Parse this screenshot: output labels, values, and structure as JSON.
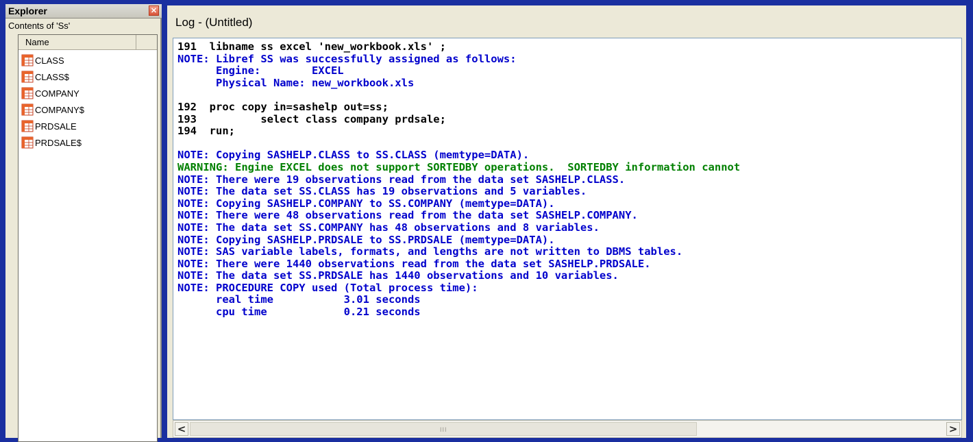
{
  "explorer": {
    "title": "Explorer",
    "close_icon": "close-icon",
    "contents_label": "Contents of 'Ss'",
    "column_header": "Name",
    "items": [
      {
        "label": "CLASS",
        "icon": "dataset-icon"
      },
      {
        "label": "CLASS$",
        "icon": "dataset-icon"
      },
      {
        "label": "COMPANY",
        "icon": "dataset-icon"
      },
      {
        "label": "COMPANY$",
        "icon": "dataset-icon"
      },
      {
        "label": "PRDSALE",
        "icon": "dataset-icon"
      },
      {
        "label": "PRDSALE$",
        "icon": "dataset-icon"
      }
    ]
  },
  "log": {
    "title": "Log - (Untitled)",
    "lines": [
      {
        "text": "191  libname ss excel 'new_workbook.xls' ;",
        "kind": "src"
      },
      {
        "text": "NOTE: Libref SS was successfully assigned as follows:",
        "kind": "note"
      },
      {
        "text": "      Engine:        EXCEL",
        "kind": "note"
      },
      {
        "text": "      Physical Name: new_workbook.xls",
        "kind": "note"
      },
      {
        "text": "",
        "kind": "src"
      },
      {
        "text": "192  proc copy in=sashelp out=ss;",
        "kind": "src"
      },
      {
        "text": "193          select class company prdsale;",
        "kind": "src"
      },
      {
        "text": "194  run;",
        "kind": "src"
      },
      {
        "text": "",
        "kind": "src"
      },
      {
        "text": "NOTE: Copying SASHELP.CLASS to SS.CLASS (memtype=DATA).",
        "kind": "note"
      },
      {
        "text": "WARNING: Engine EXCEL does not support SORTEDBY operations.  SORTEDBY information cannot",
        "kind": "warn"
      },
      {
        "text": "NOTE: There were 19 observations read from the data set SASHELP.CLASS.",
        "kind": "note"
      },
      {
        "text": "NOTE: The data set SS.CLASS has 19 observations and 5 variables.",
        "kind": "note"
      },
      {
        "text": "NOTE: Copying SASHELP.COMPANY to SS.COMPANY (memtype=DATA).",
        "kind": "note"
      },
      {
        "text": "NOTE: There were 48 observations read from the data set SASHELP.COMPANY.",
        "kind": "note"
      },
      {
        "text": "NOTE: The data set SS.COMPANY has 48 observations and 8 variables.",
        "kind": "note"
      },
      {
        "text": "NOTE: Copying SASHELP.PRDSALE to SS.PRDSALE (memtype=DATA).",
        "kind": "note"
      },
      {
        "text": "NOTE: SAS variable labels, formats, and lengths are not written to DBMS tables.",
        "kind": "note"
      },
      {
        "text": "NOTE: There were 1440 observations read from the data set SASHELP.PRDSALE.",
        "kind": "note"
      },
      {
        "text": "NOTE: The data set SS.PRDSALE has 1440 observations and 10 variables.",
        "kind": "note"
      },
      {
        "text": "NOTE: PROCEDURE COPY used (Total process time):",
        "kind": "note"
      },
      {
        "text": "      real time           3.01 seconds",
        "kind": "note"
      },
      {
        "text": "      cpu time            0.21 seconds",
        "kind": "note"
      }
    ]
  },
  "scrollbar": {
    "left_icon": "arrow-left-icon",
    "right_icon": "arrow-right-icon",
    "left_glyph": "<",
    "right_glyph": ">",
    "grip_glyph": "III"
  },
  "colors": {
    "background": "#1a2fa0",
    "panel": "#ece9d8",
    "note_text": "#0000cc",
    "warning_text": "#008000",
    "source_text": "#000000"
  }
}
